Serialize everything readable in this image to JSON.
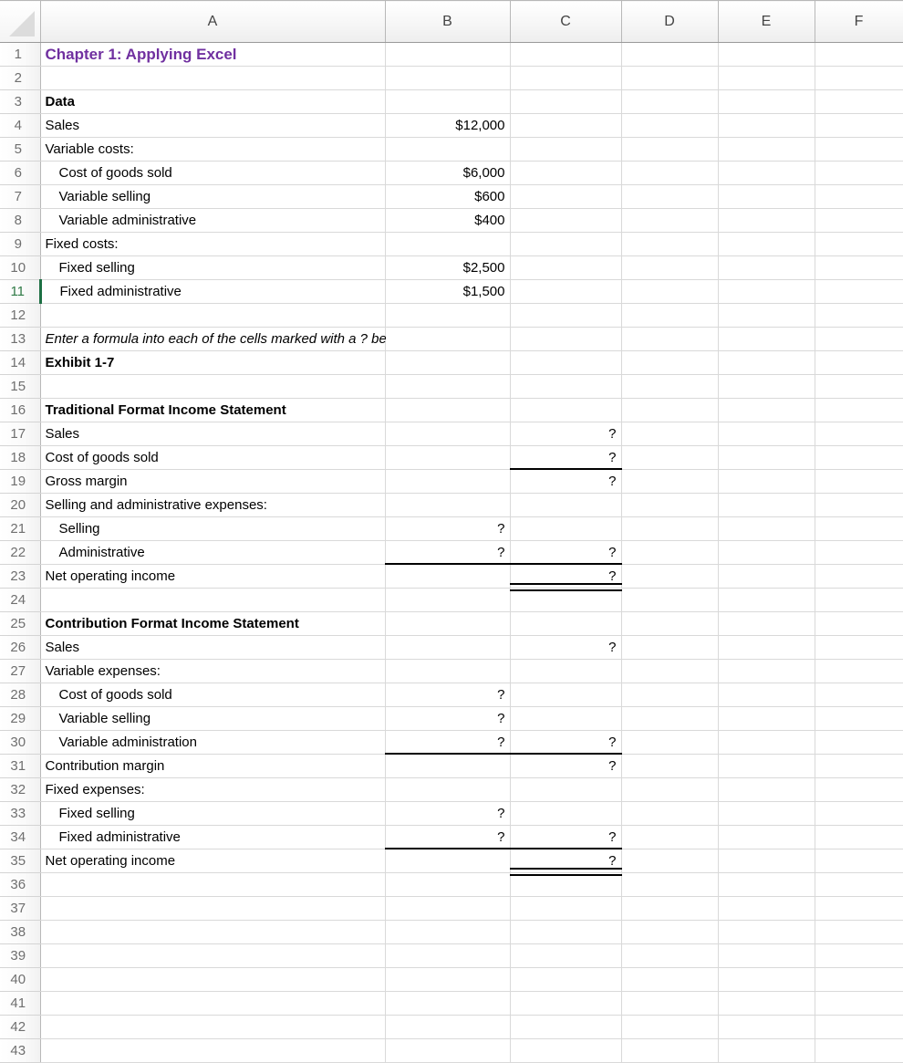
{
  "app": {
    "type": "spreadsheet",
    "select_all_corner": "select-all-triangle",
    "active_row": 11
  },
  "columns": [
    {
      "id": "A",
      "label": "A"
    },
    {
      "id": "B",
      "label": "B"
    },
    {
      "id": "C",
      "label": "C"
    },
    {
      "id": "D",
      "label": "D"
    },
    {
      "id": "E",
      "label": "E"
    },
    {
      "id": "F",
      "label": "F"
    }
  ],
  "colors": {
    "title_purple": "#7030a0",
    "active_row_green": "#1d7044",
    "gridline": "#d9d9d9",
    "header_bg": "#f2f2f2",
    "accounting_border": "#000000"
  },
  "rows": [
    {
      "n": 1,
      "A": "Chapter 1: Applying Excel",
      "B": "",
      "C": "",
      "D": "",
      "E": "",
      "F": ""
    },
    {
      "n": 2,
      "A": "",
      "B": "",
      "C": "",
      "D": "",
      "E": "",
      "F": ""
    },
    {
      "n": 3,
      "A": "Data",
      "B": "",
      "C": "",
      "D": "",
      "E": "",
      "F": ""
    },
    {
      "n": 4,
      "A": "Sales",
      "B": "$12,000",
      "C": "",
      "D": "",
      "E": "",
      "F": ""
    },
    {
      "n": 5,
      "A": "Variable costs:",
      "B": "",
      "C": "",
      "D": "",
      "E": "",
      "F": ""
    },
    {
      "n": 6,
      "A": "Cost of goods sold",
      "B": "$6,000",
      "C": "",
      "D": "",
      "E": "",
      "F": ""
    },
    {
      "n": 7,
      "A": "Variable selling",
      "B": "$600",
      "C": "",
      "D": "",
      "E": "",
      "F": ""
    },
    {
      "n": 8,
      "A": "Variable administrative",
      "B": "$400",
      "C": "",
      "D": "",
      "E": "",
      "F": ""
    },
    {
      "n": 9,
      "A": "Fixed costs:",
      "B": "",
      "C": "",
      "D": "",
      "E": "",
      "F": ""
    },
    {
      "n": 10,
      "A": "Fixed selling",
      "B": "$2,500",
      "C": "",
      "D": "",
      "E": "",
      "F": ""
    },
    {
      "n": 11,
      "A": "Fixed administrative",
      "B": "$1,500",
      "C": "",
      "D": "",
      "E": "",
      "F": ""
    },
    {
      "n": 12,
      "A": "",
      "B": "",
      "C": "",
      "D": "",
      "E": "",
      "F": ""
    },
    {
      "n": 13,
      "A": "Enter a formula into each of the cells marked with a ? below",
      "B": "",
      "C": "",
      "D": "",
      "E": "",
      "F": ""
    },
    {
      "n": 14,
      "A": "Exhibit 1-7",
      "B": "",
      "C": "",
      "D": "",
      "E": "",
      "F": ""
    },
    {
      "n": 15,
      "A": "",
      "B": "",
      "C": "",
      "D": "",
      "E": "",
      "F": ""
    },
    {
      "n": 16,
      "A": "Traditional Format Income Statement",
      "B": "",
      "C": "",
      "D": "",
      "E": "",
      "F": ""
    },
    {
      "n": 17,
      "A": "Sales",
      "B": "",
      "C": "?",
      "D": "",
      "E": "",
      "F": ""
    },
    {
      "n": 18,
      "A": "Cost of goods sold",
      "B": "",
      "C": "?",
      "D": "",
      "E": "",
      "F": ""
    },
    {
      "n": 19,
      "A": "Gross margin",
      "B": "",
      "C": "?",
      "D": "",
      "E": "",
      "F": ""
    },
    {
      "n": 20,
      "A": "Selling and administrative expenses:",
      "B": "",
      "C": "",
      "D": "",
      "E": "",
      "F": ""
    },
    {
      "n": 21,
      "A": "Selling",
      "B": "?",
      "C": "",
      "D": "",
      "E": "",
      "F": ""
    },
    {
      "n": 22,
      "A": "Administrative",
      "B": "?",
      "C": "?",
      "D": "",
      "E": "",
      "F": ""
    },
    {
      "n": 23,
      "A": "Net operating income",
      "B": "",
      "C": "?",
      "D": "",
      "E": "",
      "F": ""
    },
    {
      "n": 24,
      "A": "",
      "B": "",
      "C": "",
      "D": "",
      "E": "",
      "F": ""
    },
    {
      "n": 25,
      "A": "Contribution Format Income Statement",
      "B": "",
      "C": "",
      "D": "",
      "E": "",
      "F": ""
    },
    {
      "n": 26,
      "A": "Sales",
      "B": "",
      "C": "?",
      "D": "",
      "E": "",
      "F": ""
    },
    {
      "n": 27,
      "A": "Variable expenses:",
      "B": "",
      "C": "",
      "D": "",
      "E": "",
      "F": ""
    },
    {
      "n": 28,
      "A": "Cost of goods sold",
      "B": "?",
      "C": "",
      "D": "",
      "E": "",
      "F": ""
    },
    {
      "n": 29,
      "A": "Variable selling",
      "B": "?",
      "C": "",
      "D": "",
      "E": "",
      "F": ""
    },
    {
      "n": 30,
      "A": "Variable administration",
      "B": "?",
      "C": "?",
      "D": "",
      "E": "",
      "F": ""
    },
    {
      "n": 31,
      "A": "Contribution margin",
      "B": "",
      "C": "?",
      "D": "",
      "E": "",
      "F": ""
    },
    {
      "n": 32,
      "A": "Fixed expenses:",
      "B": "",
      "C": "",
      "D": "",
      "E": "",
      "F": ""
    },
    {
      "n": 33,
      "A": "Fixed selling",
      "B": "?",
      "C": "",
      "D": "",
      "E": "",
      "F": ""
    },
    {
      "n": 34,
      "A": "Fixed administrative",
      "B": "?",
      "C": "?",
      "D": "",
      "E": "",
      "F": ""
    },
    {
      "n": 35,
      "A": "Net operating income",
      "B": "",
      "C": "?",
      "D": "",
      "E": "",
      "F": ""
    },
    {
      "n": 36,
      "A": "",
      "B": "",
      "C": "",
      "D": "",
      "E": "",
      "F": ""
    },
    {
      "n": 37,
      "A": "",
      "B": "",
      "C": "",
      "D": "",
      "E": "",
      "F": ""
    },
    {
      "n": 38,
      "A": "",
      "B": "",
      "C": "",
      "D": "",
      "E": "",
      "F": ""
    },
    {
      "n": 39,
      "A": "",
      "B": "",
      "C": "",
      "D": "",
      "E": "",
      "F": ""
    },
    {
      "n": 40,
      "A": "",
      "B": "",
      "C": "",
      "D": "",
      "E": "",
      "F": ""
    },
    {
      "n": 41,
      "A": "",
      "B": "",
      "C": "",
      "D": "",
      "E": "",
      "F": ""
    },
    {
      "n": 42,
      "A": "",
      "B": "",
      "C": "",
      "D": "",
      "E": "",
      "F": ""
    },
    {
      "n": 43,
      "A": "",
      "B": "",
      "C": "",
      "D": "",
      "E": "",
      "F": ""
    }
  ],
  "row_labels": {
    "1": "1",
    "2": "2",
    "3": "3",
    "4": "4",
    "5": "5",
    "6": "6",
    "7": "7",
    "8": "8",
    "9": "9",
    "10": "10",
    "11": "11",
    "12": "12",
    "13": "13",
    "14": "14",
    "15": "15",
    "16": "16",
    "17": "17",
    "18": "18",
    "19": "19",
    "20": "20",
    "21": "21",
    "22": "22",
    "23": "23",
    "24": "24",
    "25": "25",
    "26": "26",
    "27": "27",
    "28": "28",
    "29": "29",
    "30": "30",
    "31": "31",
    "32": "32",
    "33": "33",
    "34": "34",
    "35": "35",
    "36": "36",
    "37": "37",
    "38": "38",
    "39": "39",
    "40": "40",
    "41": "41",
    "42": "42",
    "43": "43"
  },
  "formatting": {
    "title_row": 1,
    "bold_rows": [
      3,
      14,
      16,
      25
    ],
    "italic_rows": [
      13
    ],
    "indented_rows": [
      6,
      7,
      8,
      10,
      11,
      21,
      22,
      28,
      29,
      30,
      33,
      34
    ],
    "right_aligned_cols": [
      "B",
      "C"
    ],
    "single_underline": [
      {
        "row": 18,
        "cols": [
          "C"
        ]
      },
      {
        "row": 22,
        "cols": [
          "B",
          "C"
        ]
      },
      {
        "row": 30,
        "cols": [
          "B",
          "C"
        ]
      },
      {
        "row": 34,
        "cols": [
          "B",
          "C"
        ]
      }
    ],
    "double_underline": [
      {
        "row": 23,
        "cols": [
          "C"
        ]
      },
      {
        "row": 35,
        "cols": [
          "C"
        ]
      }
    ]
  }
}
